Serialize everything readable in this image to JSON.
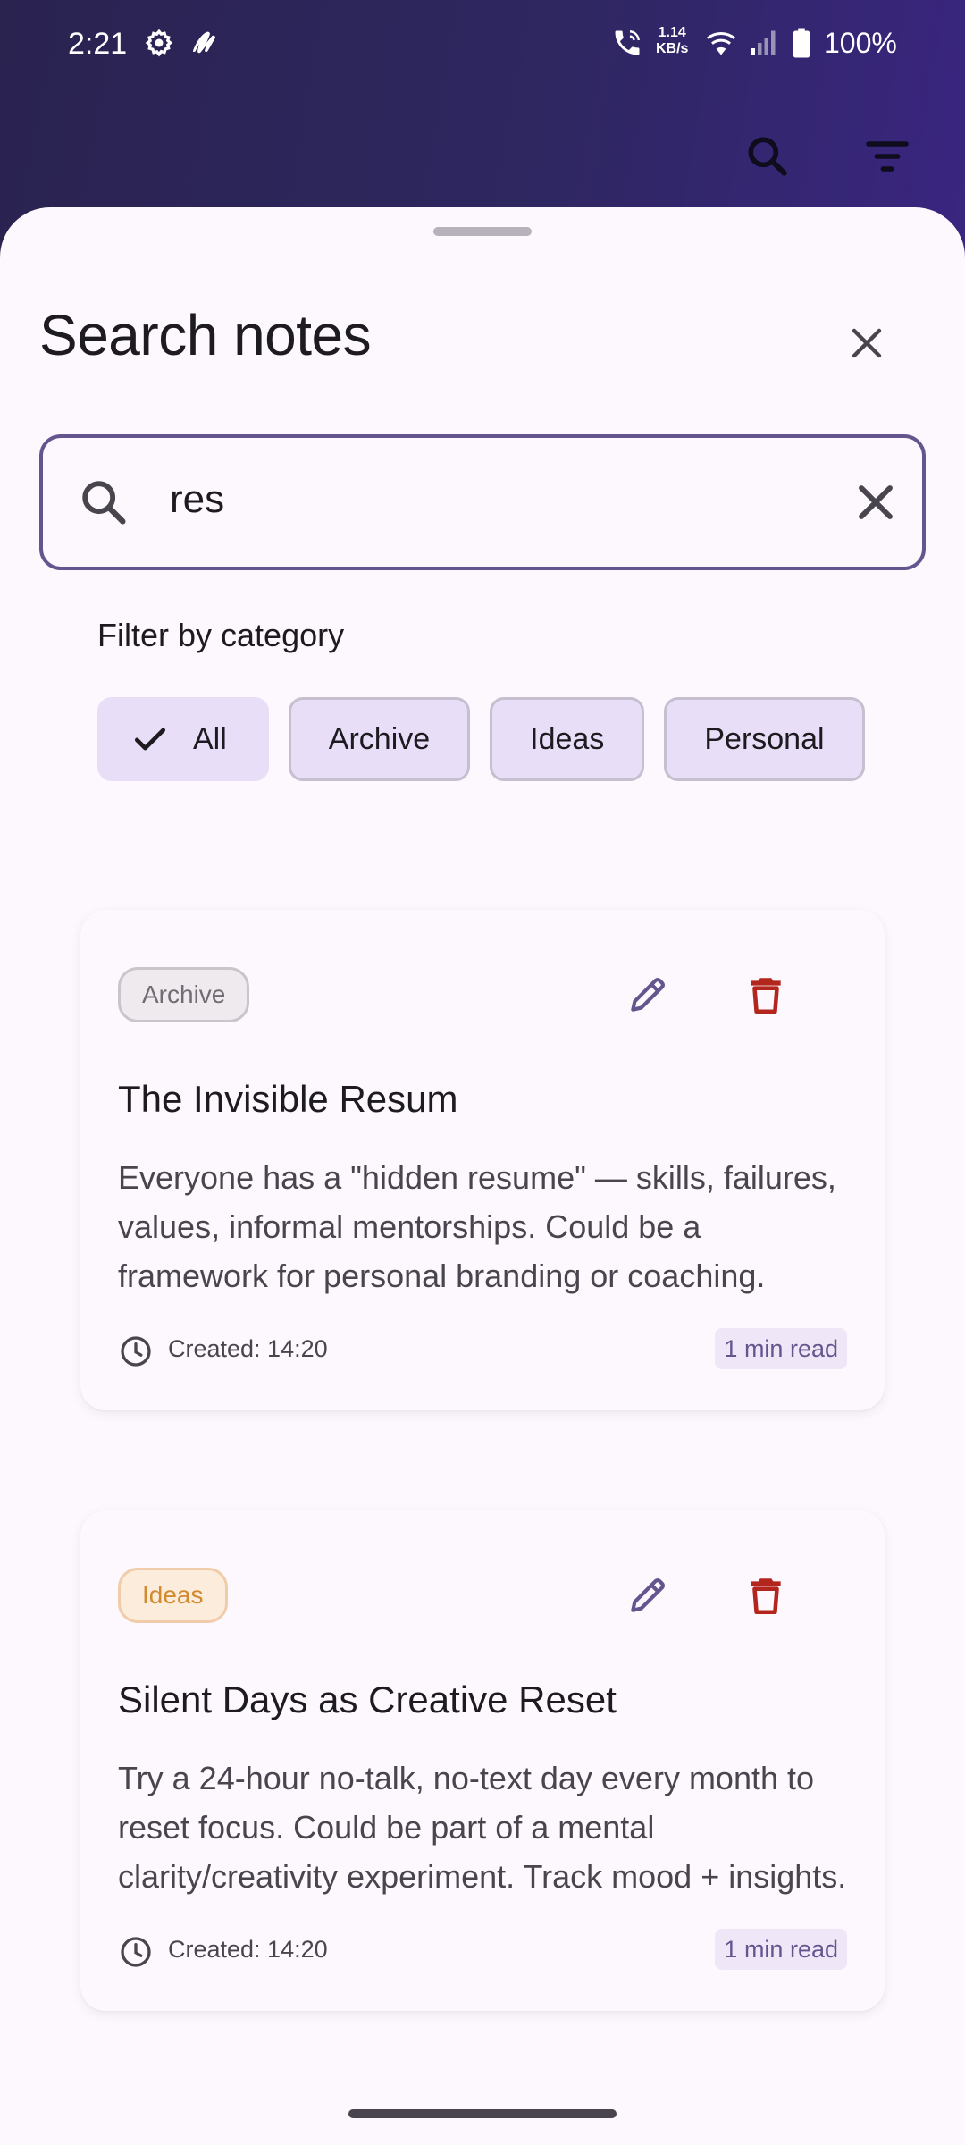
{
  "status_bar": {
    "time": "2:21",
    "net_speed_value": "1.14",
    "net_speed_unit": "KB/s",
    "battery": "100%",
    "icons": [
      "gear-icon",
      "app-notification-icon",
      "wifi-call-icon",
      "wifi-icon",
      "cell-signal-icon",
      "battery-icon"
    ]
  },
  "toolbar": {
    "icons": [
      "search-icon",
      "filter-icon"
    ]
  },
  "sheet": {
    "title": "Search notes",
    "search": {
      "value": "res"
    },
    "filter_label": "Filter by category",
    "chips": [
      {
        "label": "All",
        "selected": true
      },
      {
        "label": "Archive",
        "selected": false
      },
      {
        "label": "Ideas",
        "selected": false
      },
      {
        "label": "Personal",
        "selected": false
      }
    ]
  },
  "notes": [
    {
      "category": "Archive",
      "title": "The Invisible Resum",
      "body": "Everyone has a \"hidden resume\" — skills, failures, values, informal mentorships. Could be a framework for personal branding or coaching.",
      "created": "Created: 14:20",
      "read_time": "1 min read"
    },
    {
      "category": "Ideas",
      "title": "Silent Days as Creative Reset",
      "body": "Try a 24-hour no-talk, no-text day every month to reset focus. Could be part of a mental clarity/creativity experiment. Track mood + insights.",
      "created": "Created: 14:20",
      "read_time": "1 min read"
    }
  ],
  "colors": {
    "accent": "#65558f",
    "delete": "#b3261e",
    "chip_bg": "#e8def8",
    "ideas_badge": "#d18a2e",
    "app_bar": "#2e2760"
  }
}
